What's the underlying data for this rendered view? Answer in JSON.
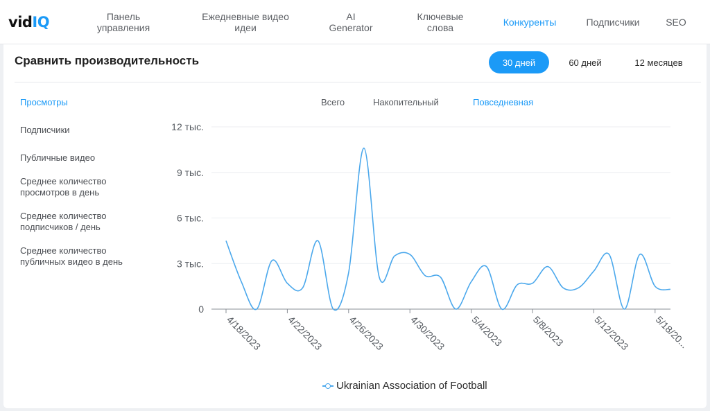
{
  "brand": {
    "logo_vid": "vid",
    "logo_iq": "IQ"
  },
  "nav": {
    "items": [
      {
        "label": "Панель\nуправления",
        "active": false
      },
      {
        "label": "Ежедневные видео\nидеи",
        "active": false
      },
      {
        "label": "AI\nGenerator",
        "active": false
      },
      {
        "label": "Ключевые\nслова",
        "active": false
      },
      {
        "label": "Конкуренты",
        "active": true
      },
      {
        "label": "Подписчики",
        "active": false
      },
      {
        "label": "SEO",
        "active": false
      }
    ]
  },
  "panel": {
    "title": "Сравнить производительность",
    "ranges": [
      {
        "label": "30 дней",
        "active": true
      },
      {
        "label": "60 дней",
        "active": false
      },
      {
        "label": "12 месяцев",
        "active": false
      }
    ],
    "metrics": [
      {
        "label": "Просмотры",
        "active": true
      },
      {
        "label": "Подписчики",
        "active": false
      },
      {
        "label": "Публичные видео",
        "active": false
      },
      {
        "label": "Среднее количество\nпросмотров в день",
        "active": false
      },
      {
        "label": "Среднее количество\nподписчиков / день",
        "active": false
      },
      {
        "label": "Среднее количество\nпубличных видео в день",
        "active": false
      }
    ],
    "modes": [
      {
        "label": "Всего",
        "active": false
      },
      {
        "label": "Накопительный",
        "active": false
      },
      {
        "label": "Повседневная",
        "active": true
      }
    ]
  },
  "colors": {
    "accent": "#1b9af7",
    "series": "#4ba8ec"
  },
  "chart_data": {
    "type": "line",
    "ylim": [
      0,
      12000
    ],
    "yticks": [
      {
        "value": 0,
        "label": "0"
      },
      {
        "value": 3000,
        "label": "3 тыс."
      },
      {
        "value": 6000,
        "label": "6 тыс."
      },
      {
        "value": 9000,
        "label": "9 тыс."
      },
      {
        "value": 12000,
        "label": "12 тыс."
      }
    ],
    "xtick_labels": [
      "4/18/2023",
      "4/22/2023",
      "4/26/2023",
      "4/30/2023",
      "5/4/2023",
      "5/8/2023",
      "5/12/2023",
      "5/18/20..."
    ],
    "x": [
      "4/18/2023",
      "4/19/2023",
      "4/20/2023",
      "4/21/2023",
      "4/22/2023",
      "4/23/2023",
      "4/24/2023",
      "4/25/2023",
      "4/26/2023",
      "4/27/2023",
      "4/28/2023",
      "4/29/2023",
      "4/30/2023",
      "5/1/2023",
      "5/2/2023",
      "5/3/2023",
      "5/4/2023",
      "5/5/2023",
      "5/6/2023",
      "5/7/2023",
      "5/8/2023",
      "5/9/2023",
      "5/10/2023",
      "5/11/2023",
      "5/12/2023",
      "5/13/2023",
      "5/14/2023",
      "5/15/2023",
      "5/16/2023",
      "5/17/2023"
    ],
    "series": [
      {
        "name": "Ukrainian Association of Football",
        "values": [
          4500,
          1800,
          0,
          3200,
          1700,
          1400,
          4500,
          0,
          2400,
          10600,
          2100,
          3500,
          3600,
          2200,
          2100,
          0,
          1800,
          2800,
          0,
          1600,
          1700,
          2800,
          1400,
          1400,
          2500,
          3600,
          0,
          3600,
          1500,
          1300
        ]
      }
    ]
  }
}
